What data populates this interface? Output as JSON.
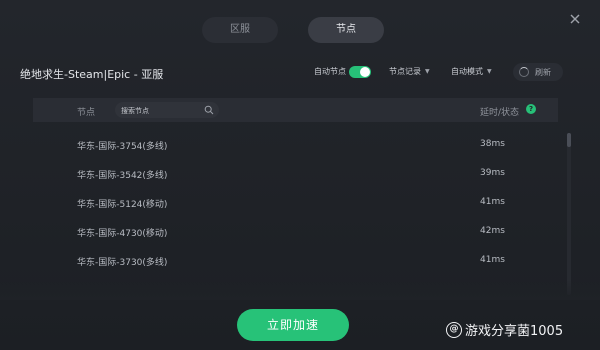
{
  "tabs": [
    {
      "label": "区服",
      "active": false
    },
    {
      "label": "节点",
      "active": true
    }
  ],
  "header": {
    "game_title": "绝地求生-Steam|Epic - 亚服",
    "auto_node_label": "自动节点",
    "auto_node_enabled": true,
    "node_record_label": "节点记录",
    "auto_mode_label": "自动模式",
    "refresh_label": "刷新"
  },
  "list": {
    "column_node": "节点",
    "search_placeholder": "搜索节点",
    "column_latency": "延时/状态",
    "help_symbol": "?",
    "rows": [
      {
        "name": "华东-国际-3754(多线)",
        "latency": "38ms"
      },
      {
        "name": "华东-国际-3542(多线)",
        "latency": "39ms"
      },
      {
        "name": "华东-国际-5124(移动)",
        "latency": "41ms"
      },
      {
        "name": "华东-国际-4730(移动)",
        "latency": "42ms"
      },
      {
        "name": "华东-国际-3730(多线)",
        "latency": "41ms"
      }
    ]
  },
  "footer": {
    "accelerate_label": "立即加速"
  },
  "watermark": {
    "logo_text": "@",
    "text": "游戏分享菌1005"
  },
  "colors": {
    "background": "#1f2228",
    "accent_green": "#27c278",
    "panel": "#2a2d34"
  },
  "icons": [
    "close-icon",
    "search-icon",
    "refresh-icon",
    "help-icon",
    "chevron-down-icon"
  ]
}
